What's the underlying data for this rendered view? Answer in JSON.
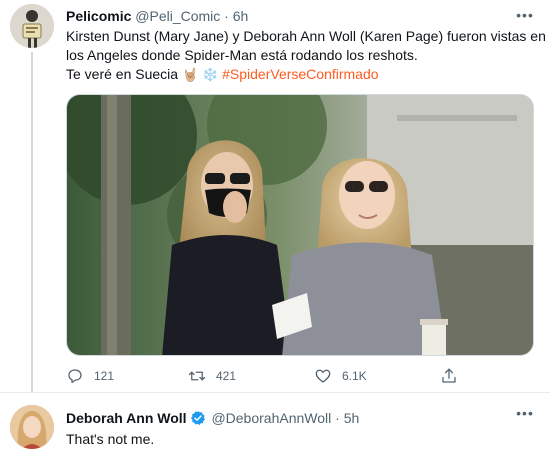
{
  "tweet": {
    "author_name": "Pelicomic",
    "author_handle": "@Peli_Comic",
    "separator": "·",
    "time": "6h",
    "text_line_1": "Kirsten Dunst (Mary Jane) y Deborah Ann Woll (Karen Page) fueron vistas en",
    "text_line_2": "los Angeles donde Spider-Man está rodando los reshots.",
    "text_line_3": "Te veré en Suecia",
    "emoji_1": "🤘🏼",
    "emoji_2": "❄️",
    "hashtag": "#SpiderVerseConfirmado",
    "more_label": "•••",
    "hashtag_color": "#ff5a1f",
    "actions": {
      "replies": "121",
      "retweets": "421",
      "likes": "6.1K"
    }
  },
  "reply": {
    "author_name": "Deborah Ann Woll",
    "author_handle": "@DeborahAnnWoll",
    "separator": "·",
    "time": "5h",
    "text": "That's not me.",
    "more_label": "•••",
    "verified_color": "#1d9bf0"
  }
}
